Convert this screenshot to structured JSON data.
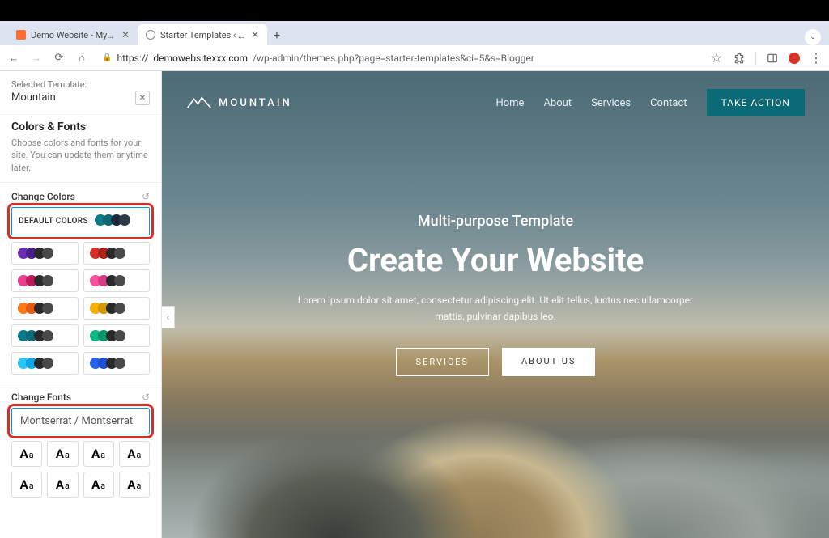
{
  "browser": {
    "tabs": [
      {
        "title": "Demo Website - MyKinsta",
        "active": false,
        "favicon": "kinsta"
      },
      {
        "title": "Starter Templates ‹ Demo Sit",
        "active": true,
        "favicon": "globe"
      }
    ],
    "url_domain": "demowebsitexxx.com",
    "url_path": "/wp-admin/themes.php?page=starter-templates&ci=5&s=Blogger",
    "url_prefix": "https://"
  },
  "sidebar": {
    "selected_label": "Selected Template:",
    "selected_value": "Mountain",
    "colors_fonts_heading": "Colors & Fonts",
    "colors_fonts_desc": "Choose colors and fonts for your site. You can update them anytime later.",
    "change_colors_heading": "Change Colors",
    "default_colors_label": "DEFAULT COLORS",
    "default_palette": [
      "#0a7b87",
      "#0a6a75",
      "#1b2a3a",
      "#2e3a46"
    ],
    "palettes": [
      [
        "#6b2fb3",
        "#4a1e8a",
        "#2a2a2a",
        "#4a4a4a"
      ],
      [
        "#d7302a",
        "#b01f1a",
        "#2a2a2a",
        "#4a4a4a"
      ],
      [
        "#e83e8c",
        "#c2185b",
        "#2a2a2a",
        "#4a4a4a"
      ],
      [
        "#ff4fa3",
        "#d83a8a",
        "#2a2a2a",
        "#4a4a4a"
      ],
      [
        "#ff7a18",
        "#e8590c",
        "#2a2a2a",
        "#4a4a4a"
      ],
      [
        "#f5b301",
        "#d49a00",
        "#2a2a2a",
        "#4a4a4a"
      ],
      [
        "#0a7b87",
        "#0a6a75",
        "#2a2a2a",
        "#4a4a4a"
      ],
      [
        "#10b981",
        "#059669",
        "#2a2a2a",
        "#4a4a4a"
      ],
      [
        "#29c5f6",
        "#0ea5e9",
        "#2a2a2a",
        "#4a4a4a"
      ],
      [
        "#2563eb",
        "#1d4ed8",
        "#2a2a2a",
        "#4a4a4a"
      ]
    ],
    "change_fonts_heading": "Change Fonts",
    "font_selected": "Montserrat / Montserrat",
    "font_sample": "Aa",
    "font_count": 8
  },
  "preview": {
    "logo_text": "MOUNTAIN",
    "nav": [
      "Home",
      "About",
      "Services",
      "Contact"
    ],
    "cta": "TAKE ACTION",
    "hero_sub": "Multi-purpose Template",
    "hero_title": "Create Your Website",
    "hero_desc": "Lorem ipsum dolor sit amet, consectetur adipiscing elit. Ut elit tellus, luctus nec ullamcorper mattis, pulvinar dapibus leo.",
    "btn_services": "SERVICES",
    "btn_about": "ABOUT US"
  }
}
